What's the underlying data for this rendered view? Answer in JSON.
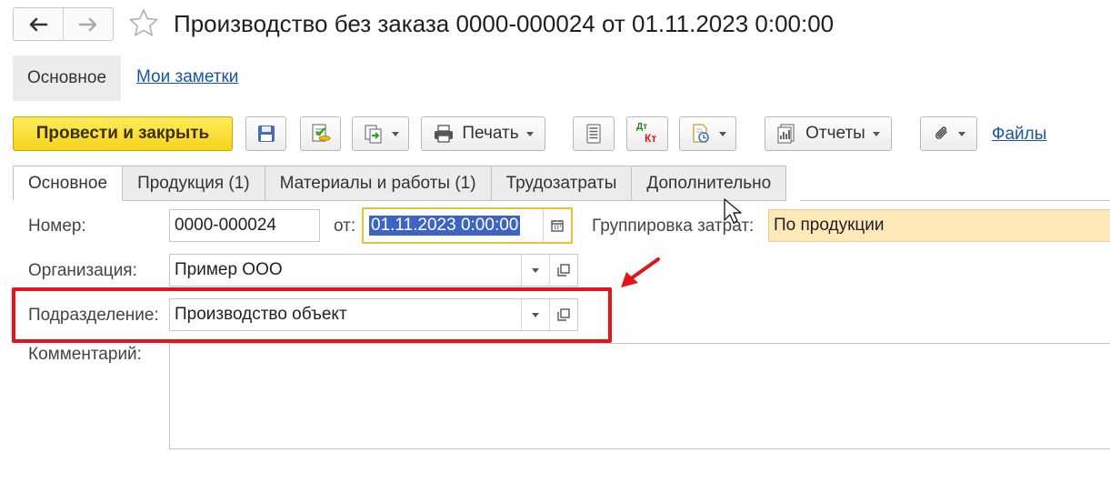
{
  "window": {
    "title": "Производство без заказа 0000-000024 от 01.11.2023 0:00:00"
  },
  "form_tabs": {
    "main": "Основное",
    "notes": "Мои заметки"
  },
  "toolbar": {
    "post_close": "Провести и закрыть",
    "print": "Печать",
    "reports": "Отчеты",
    "files": "Файлы",
    "dt_kt_top": "Дт",
    "dt_kt_bottom": "Кт"
  },
  "page_tabs": [
    "Основное",
    "Продукция (1)",
    "Материалы и работы (1)",
    "Трудозатраты",
    "Дополнительно"
  ],
  "fields": {
    "number_label": "Номер:",
    "number_value": "0000-000024",
    "date_label": "от:",
    "date_value": "01.11.2023  0:00:00",
    "grouping_label": "Группировка затрат:",
    "grouping_value": "По продукции",
    "org_label": "Организация:",
    "org_value": "Пример ООО",
    "dept_label": "Подразделение:",
    "dept_value": "Производство объект",
    "comment_label": "Комментарий:",
    "comment_value": ""
  },
  "colors": {
    "primary_button": "#f5d41c",
    "link": "#1a54a8",
    "highlight_box": "#e3141b",
    "annotation_arrow": "#e3141b",
    "grouping_field_bg": "#fde8b8",
    "date_field_border": "#e8c23a",
    "selection": "#3d63c4"
  },
  "icons": [
    "back-arrow-icon",
    "forward-arrow-icon",
    "star-icon",
    "save-icon",
    "post-icon",
    "create-based-on-icon",
    "print-icon",
    "list-icon",
    "dt-kt-icon",
    "related-docs-icon",
    "reports-icon",
    "paperclip-icon",
    "calendar-icon",
    "dropdown-icon",
    "open-icon",
    "mouse-cursor-icon",
    "annotation-arrow-icon"
  ]
}
